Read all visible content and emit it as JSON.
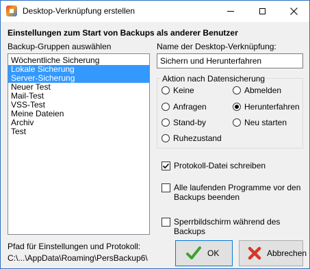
{
  "window": {
    "title": "Desktop-Verknüpfung erstellen"
  },
  "heading": "Einstellungen zum Start von Backups als anderer Benutzer",
  "groups": {
    "label": "Backup-Gruppen auswählen",
    "items": [
      {
        "label": "Wöchentliche Sicherung",
        "selected": false
      },
      {
        "label": "Lokale Sicherung",
        "selected": true
      },
      {
        "label": "Server-Sicherung",
        "selected": true
      },
      {
        "label": "Neuer Test",
        "selected": false
      },
      {
        "label": "Mail-Test",
        "selected": false
      },
      {
        "label": "VSS-Test",
        "selected": false
      },
      {
        "label": "Meine Dateien",
        "selected": false
      },
      {
        "label": "Archiv",
        "selected": false
      },
      {
        "label": "Test",
        "selected": false
      }
    ]
  },
  "shortcut": {
    "label": "Name der Desktop-Verknüpfung:",
    "value": "Sichern und Herunterfahren"
  },
  "action": {
    "legend": "Aktion nach Datensicherung",
    "options": [
      {
        "label": "Keine",
        "checked": false
      },
      {
        "label": "Abmelden",
        "checked": false
      },
      {
        "label": "Anfragen",
        "checked": false
      },
      {
        "label": "Herunterfahren",
        "checked": true
      },
      {
        "label": "Stand-by",
        "checked": false
      },
      {
        "label": "Neu starten",
        "checked": false
      },
      {
        "label": "Ruhezustand",
        "checked": false
      }
    ]
  },
  "options": {
    "protocol": {
      "label": "Protokoll-Datei schreiben",
      "checked": true
    },
    "close_programs": {
      "label": "Alle laufenden Programme vor den Backups beenden",
      "checked": false
    },
    "lock_screen": {
      "label": "Sperrbildschirm während des Backups",
      "checked": false
    }
  },
  "path": {
    "label": "Pfad für Einstellungen und Protokoll:",
    "value": "C:\\...\\AppData\\Roaming\\PersBackup6\\"
  },
  "buttons": {
    "ok": "OK",
    "cancel": "Abbrechen"
  },
  "colors": {
    "selection": "#3399ff",
    "ok_check": "#3aa32c",
    "cancel_x": "#d9352b",
    "window_border": "#2b6fc0"
  }
}
